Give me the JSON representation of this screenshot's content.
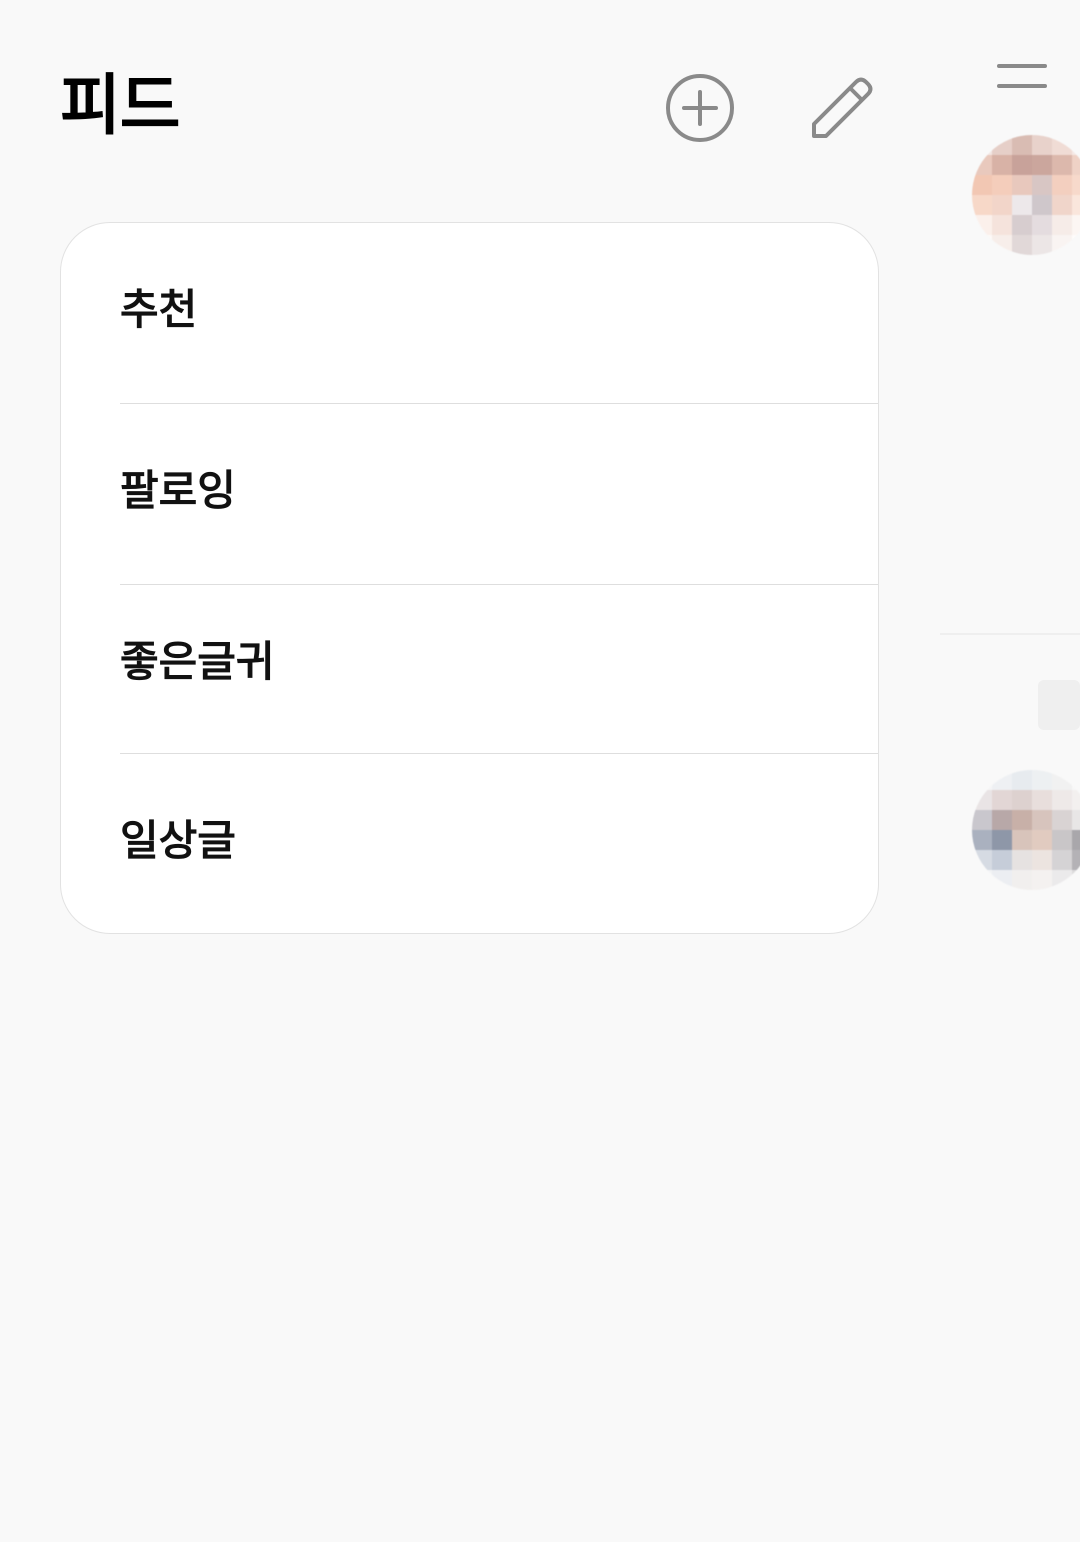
{
  "header": {
    "title": "피드",
    "add_icon": "plus-circle-icon",
    "edit_icon": "pencil-icon"
  },
  "feed_menu": {
    "items": [
      {
        "label": "추천"
      },
      {
        "label": "팔로잉"
      },
      {
        "label": "좋은글귀"
      },
      {
        "label": "일상글"
      }
    ]
  },
  "background_page": {
    "menu_icon": "hamburger-menu-icon"
  },
  "colors": {
    "background": "#f9f9f9",
    "card": "#ffffff",
    "icon": "#8a8a8a",
    "text": "#111111"
  }
}
